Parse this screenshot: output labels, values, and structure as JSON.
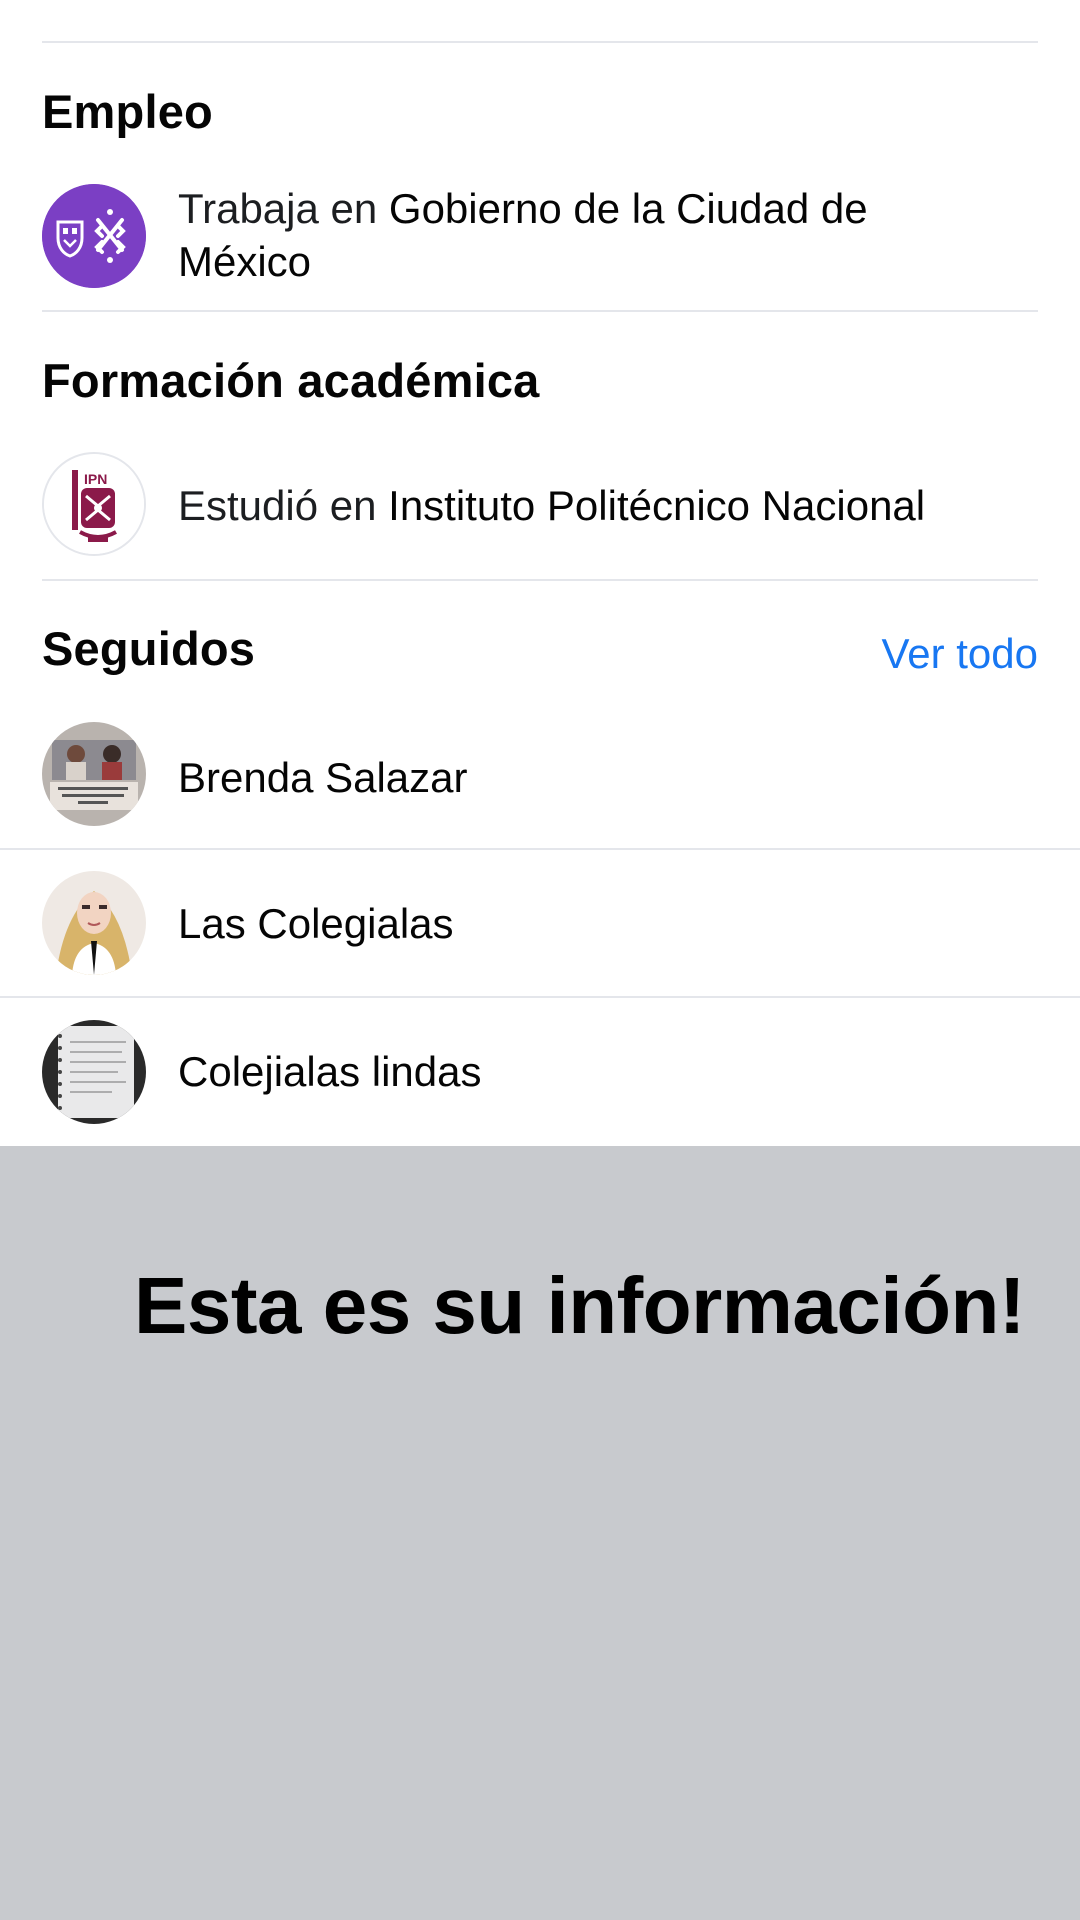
{
  "employment": {
    "heading": "Empleo",
    "prefix": "Trabaja en ",
    "org_line1": "Gobierno de la Ciudad de",
    "org_line2": "México",
    "logo_icon": "cdmx-logo-icon",
    "logo_color": "#7b3fc4"
  },
  "education": {
    "heading": "Formación académica",
    "prefix": "Estudió en ",
    "org": "Instituto Politécnico Nacional",
    "logo_icon": "ipn-logo-icon",
    "logo_color": "#8b1a4a"
  },
  "following": {
    "heading": "Seguidos",
    "see_all_label": "Ver todo",
    "accent_color": "#1877f2",
    "items": [
      {
        "name": "Brenda Salazar",
        "avatar_icon": "profile-photo-icon"
      },
      {
        "name": "Las Colegialas",
        "avatar_icon": "profile-photo-icon"
      },
      {
        "name": "Colejialas lindas",
        "avatar_icon": "notebook-photo-icon"
      }
    ]
  },
  "overlay": {
    "caption": "Esta es su información!",
    "background_color": "#c8cace"
  }
}
